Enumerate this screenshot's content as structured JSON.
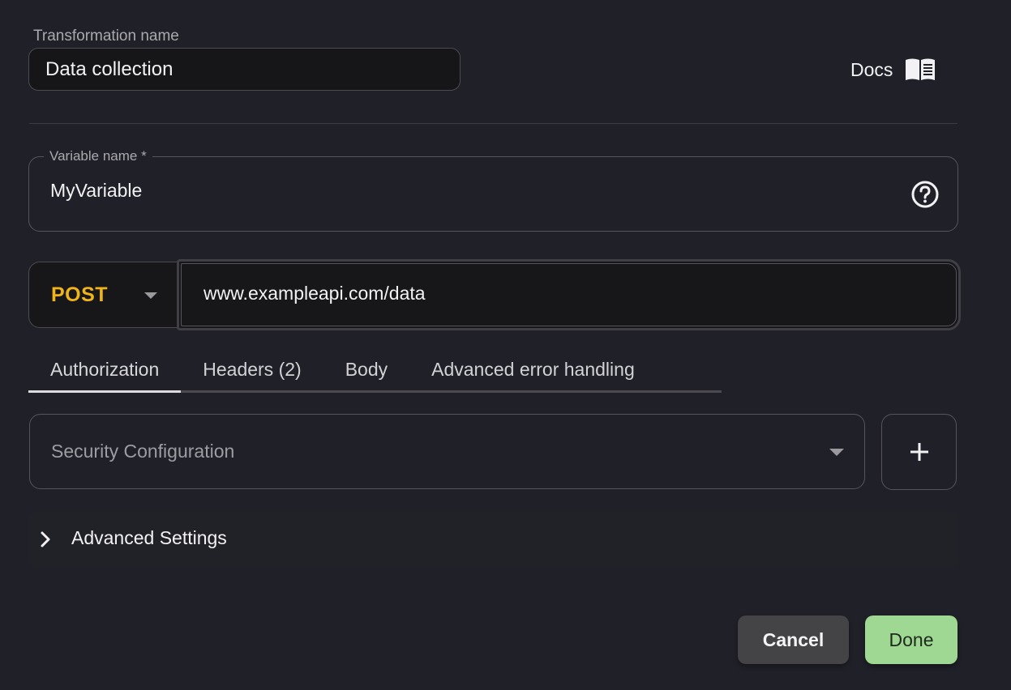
{
  "transformation": {
    "label": "Transformation name",
    "value": "Data collection"
  },
  "docs": {
    "label": "Docs",
    "icon": "book-open-icon"
  },
  "variable": {
    "label": "Variable name *",
    "value": "MyVariable",
    "help_icon": "help-circle-icon"
  },
  "request": {
    "method": "POST",
    "method_color": "#eeb418",
    "url": "www.exampleapi.com/data"
  },
  "tabs": [
    {
      "label": "Authorization",
      "active": true
    },
    {
      "label": "Headers (2)",
      "active": false
    },
    {
      "label": "Body",
      "active": false
    },
    {
      "label": "Advanced error handling",
      "active": false
    }
  ],
  "security": {
    "placeholder": "Security Configuration",
    "add_icon": "plus-icon"
  },
  "advanced_settings": {
    "label": "Advanced Settings",
    "expanded": false
  },
  "footer": {
    "cancel_label": "Cancel",
    "done_label": "Done",
    "done_color": "#9fd893"
  }
}
